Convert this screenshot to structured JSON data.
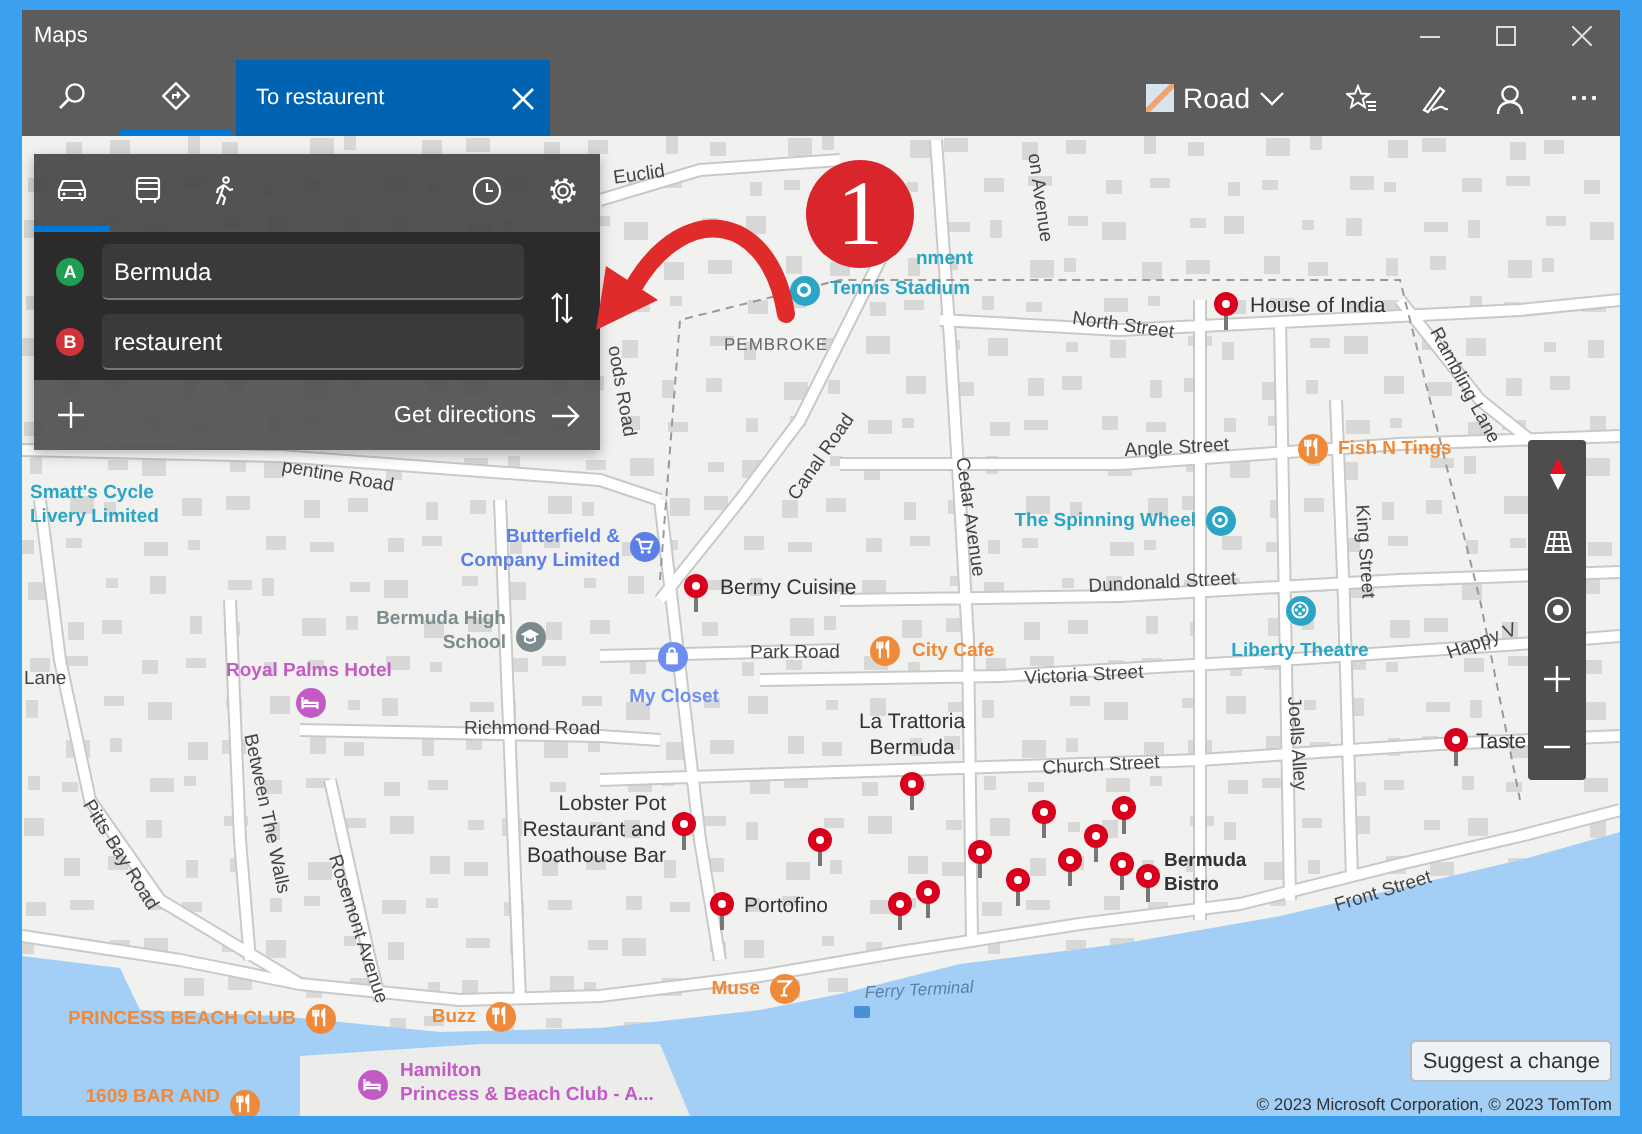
{
  "window": {
    "title": "Maps"
  },
  "toolbar": {
    "nav": [
      {
        "kind": "search",
        "selected": false
      },
      {
        "kind": "directions",
        "selected": true
      }
    ],
    "tab": {
      "label": "To restaurent"
    },
    "map_style": {
      "label": "Road"
    }
  },
  "directions": {
    "modes": [
      {
        "kind": "car",
        "selected": true
      },
      {
        "kind": "transit",
        "selected": false
      },
      {
        "kind": "walk",
        "selected": false
      }
    ],
    "waypoints": [
      {
        "marker": "A",
        "value": "Bermuda",
        "color": "#1f9d55"
      },
      {
        "marker": "B",
        "value": "restaurent",
        "color": "#d13438"
      }
    ],
    "action": "Get directions"
  },
  "map": {
    "streets": [
      {
        "text": "Euclid",
        "kind": "street"
      },
      {
        "text": "oods Road",
        "kind": "street"
      },
      {
        "text": "PEMBROKE",
        "kind": "district"
      },
      {
        "text": "on Avenue",
        "kind": "street"
      },
      {
        "text": "North Street",
        "kind": "street"
      },
      {
        "text": "Rambling Lane",
        "kind": "street"
      },
      {
        "text": "pentine Road",
        "kind": "street"
      },
      {
        "text": "Canal Road",
        "kind": "street"
      },
      {
        "text": "Cedar Avenue",
        "kind": "street"
      },
      {
        "text": "Angle Street",
        "kind": "street"
      },
      {
        "text": "King Street",
        "kind": "street"
      },
      {
        "text": "Dundonald Street",
        "kind": "street"
      },
      {
        "text": "Happy V",
        "kind": "street"
      },
      {
        "text": "Park Road",
        "kind": "street"
      },
      {
        "text": "Victoria Street",
        "kind": "street"
      },
      {
        "text": "Church Street",
        "kind": "street"
      },
      {
        "text": "Joells Alley",
        "kind": "street"
      },
      {
        "text": "Front Street",
        "kind": "street"
      },
      {
        "text": "Richmond Road",
        "kind": "street"
      },
      {
        "text": "Between The Walls",
        "kind": "street"
      },
      {
        "text": "Rosemont Avenue",
        "kind": "street"
      },
      {
        "text": "Pitts Bay Road",
        "kind": "street"
      },
      {
        "text": "Lane",
        "kind": "street"
      },
      {
        "text": "Ferry Terminal",
        "kind": "water"
      }
    ],
    "places": [
      {
        "lines": [
          "nment"
        ],
        "kind": "label",
        "color": "#2aa5c6"
      },
      {
        "lines": [
          "Tennis Stadium"
        ],
        "kind": "poi",
        "color": "#2aa5c6"
      },
      {
        "lines": [
          "House of India"
        ],
        "kind": "pin"
      },
      {
        "lines": [
          "Fish N Tings"
        ],
        "kind": "poi",
        "color": "#ef8a3a"
      },
      {
        "lines": [
          "The Spinning Wheel"
        ],
        "kind": "poi",
        "color": "#2aa5c6"
      },
      {
        "lines": [
          "City Cafe"
        ],
        "kind": "poi",
        "color": "#ef8a3a"
      },
      {
        "lines": [
          "Liberty Theatre"
        ],
        "kind": "poi",
        "color": "#2aa5c6"
      },
      {
        "lines": [
          "Bermy Cuisine"
        ],
        "kind": "pin"
      },
      {
        "lines": [
          "Butterfield &",
          "Company Limited"
        ],
        "kind": "poi",
        "color": "#5b7fe6"
      },
      {
        "lines": [
          "Bermuda High",
          "School"
        ],
        "kind": "poi",
        "color": "#7b8b8e"
      },
      {
        "lines": [
          "My Closet"
        ],
        "kind": "poi",
        "color": "#6f8ff0"
      },
      {
        "lines": [
          "Royal Palms Hotel"
        ],
        "kind": "poi",
        "color": "#c35bc7"
      },
      {
        "lines": [
          "Smatt's Cycle",
          "Livery Limited"
        ],
        "kind": "label",
        "color": "#2aa5c6"
      },
      {
        "lines": [
          "La Trattoria",
          "Bermuda"
        ],
        "kind": "pin"
      },
      {
        "lines": [
          "Lobster Pot",
          "Restaurant and",
          "Boathouse Bar"
        ],
        "kind": "pin"
      },
      {
        "lines": [
          "Portofino"
        ],
        "kind": "pin"
      },
      {
        "lines": [
          "Bermuda",
          "Bistro"
        ],
        "kind": "label",
        "color": "#333333"
      },
      {
        "lines": [
          "Taste"
        ],
        "kind": "pin"
      },
      {
        "lines": [
          "Muse"
        ],
        "kind": "poi",
        "color": "#ef8a3a"
      },
      {
        "lines": [
          "Buzz"
        ],
        "kind": "poi",
        "color": "#ef8a3a"
      },
      {
        "lines": [
          "PRINCESS BEACH CLUB"
        ],
        "kind": "poi",
        "color": "#ef8a3a"
      },
      {
        "lines": [
          "1609 BAR AND"
        ],
        "kind": "poi",
        "color": "#ef8a3a"
      },
      {
        "lines": [
          "Hamilton",
          "Princess & Beach Club - A..."
        ],
        "kind": "poi",
        "color": "#c35bc7"
      }
    ]
  },
  "suggest_button": "Suggest a change",
  "copyright": "© 2023 Microsoft Corporation, © 2023 TomTom",
  "annotation": {
    "label": "1"
  }
}
